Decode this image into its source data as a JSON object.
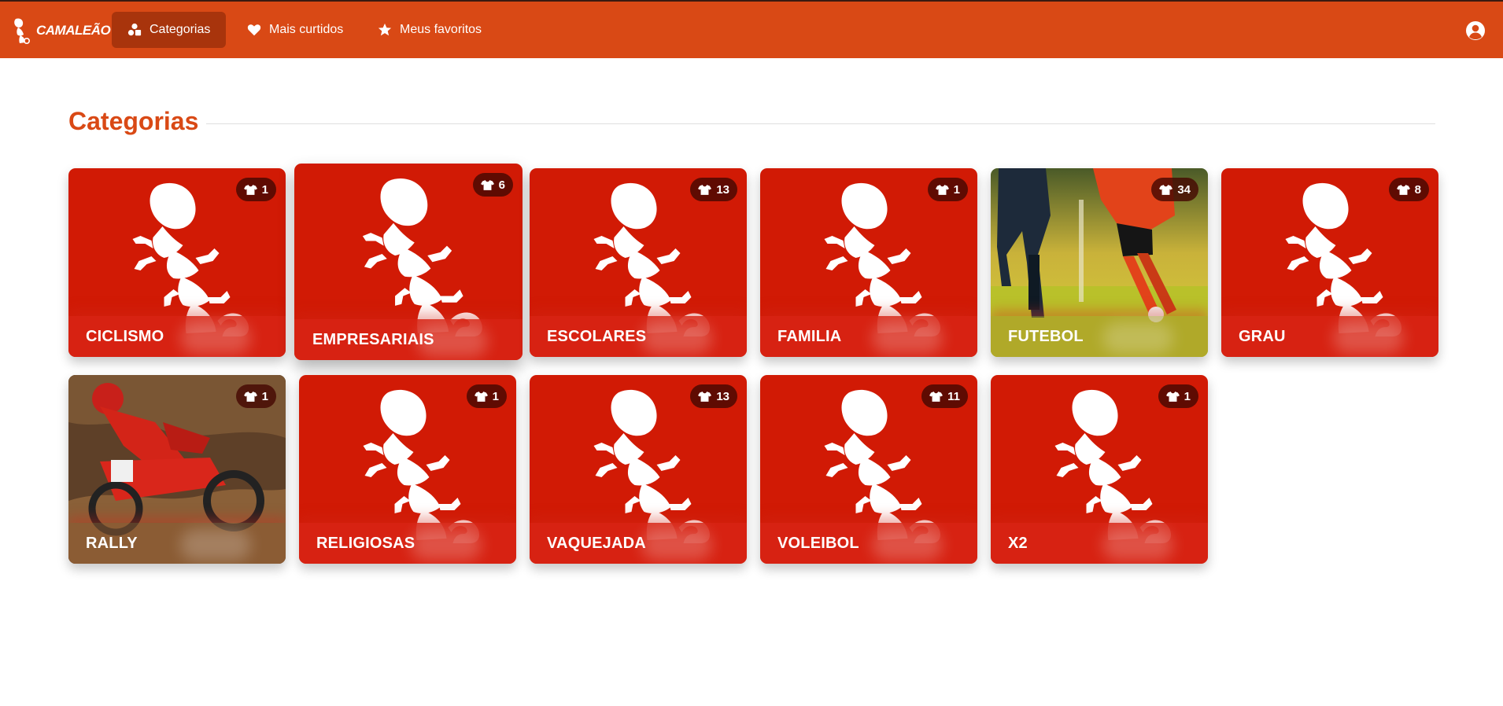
{
  "header": {
    "brand": "CAMALEÃO",
    "nav": [
      {
        "label": "Categorias",
        "icon": "shapes-icon",
        "active": true
      },
      {
        "label": "Mais curtidos",
        "icon": "heart-icon",
        "active": false
      },
      {
        "label": "Meus favoritos",
        "icon": "star-icon",
        "active": false
      }
    ],
    "user_icon": "user-circle-icon"
  },
  "main": {
    "title": "Categorias",
    "categories": [
      {
        "name": "CICLISMO",
        "count": "1",
        "image": "mascot"
      },
      {
        "name": "EMPRESARIAIS",
        "count": "6",
        "image": "mascot"
      },
      {
        "name": "ESCOLARES",
        "count": "13",
        "image": "mascot"
      },
      {
        "name": "FAMILIA",
        "count": "1",
        "image": "mascot"
      },
      {
        "name": "FUTEBOL",
        "count": "34",
        "image": "photo-soccer"
      },
      {
        "name": "GRAU",
        "count": "8",
        "image": "mascot"
      },
      {
        "name": "RALLY",
        "count": "1",
        "image": "photo-motocross"
      },
      {
        "name": "RELIGIOSAS",
        "count": "1",
        "image": "mascot"
      },
      {
        "name": "VAQUEJADA",
        "count": "13",
        "image": "mascot"
      },
      {
        "name": "VOLEIBOL",
        "count": "11",
        "image": "mascot"
      },
      {
        "name": "X2",
        "count": "1",
        "image": "mascot"
      }
    ]
  },
  "colors": {
    "header": "#d94915",
    "active_nav": "#a8340c",
    "card": "#d11a05",
    "title": "#d94915"
  }
}
